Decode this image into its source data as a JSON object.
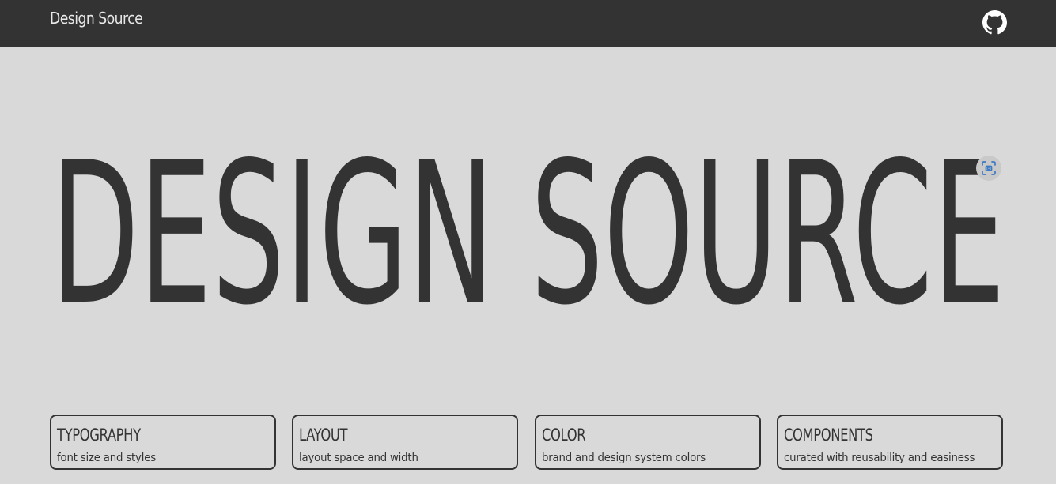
{
  "header": {
    "brand": "Design Source",
    "github_icon": "github-icon"
  },
  "hero": {
    "title": "DESIGN SOURCE",
    "overlay_icon": "screen-capture-icon"
  },
  "cards": [
    {
      "title": "TYPOGRAPHY",
      "subtitle": "font size and styles"
    },
    {
      "title": "LAYOUT",
      "subtitle": "layout space and width"
    },
    {
      "title": "COLOR",
      "subtitle": "brand and design system colors"
    },
    {
      "title": "COMPONENTS",
      "subtitle": "curated with reusability and easiness"
    }
  ],
  "colors": {
    "header_bg": "#333333",
    "page_bg": "#d9d9d9",
    "text_dark": "#333333",
    "accent_blue": "#3a79c4"
  }
}
